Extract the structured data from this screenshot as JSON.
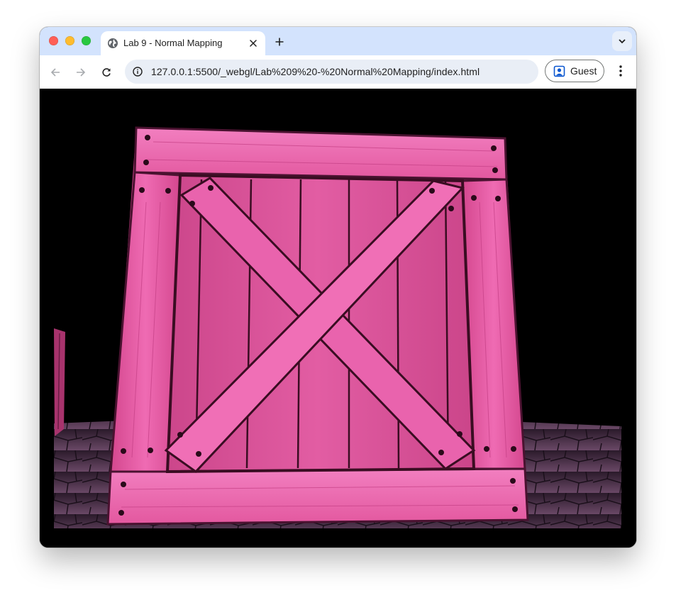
{
  "browser": {
    "tab": {
      "title": "Lab 9 - Normal Mapping",
      "favicon": "globe-icon"
    },
    "toolbar": {
      "url": "127.0.0.1:5500/_webgl/Lab%209%20-%20Normal%20Mapping/index.html",
      "profile_label": "Guest"
    },
    "icons": [
      "back-arrow-icon",
      "forward-arrow-icon",
      "reload-icon",
      "info-icon",
      "close-icon",
      "plus-icon",
      "chevron-down-icon",
      "person-icon",
      "kebab-menu-icon"
    ]
  },
  "scene": {
    "description_colors": {
      "crate": "#e8559e",
      "crate_light": "#f27fc0",
      "crate_dark": "#7a1e4c",
      "floor": "#5a3d57",
      "background": "#000000"
    }
  }
}
